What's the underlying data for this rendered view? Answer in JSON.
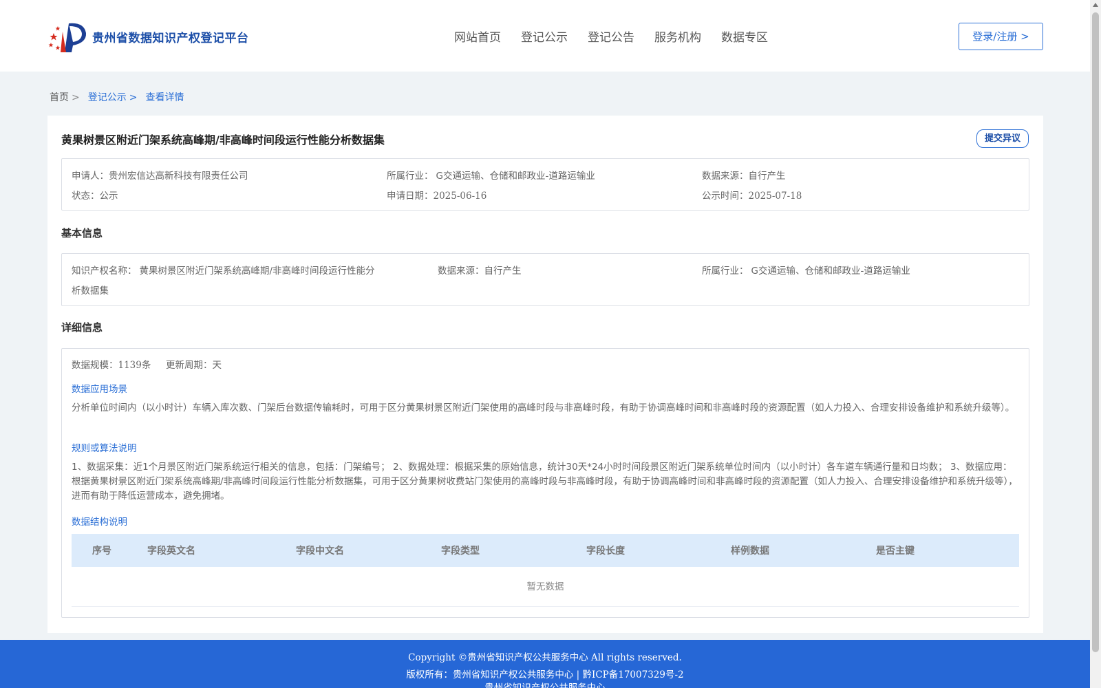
{
  "header": {
    "logo_text": "贵州省数据知识产权登记平台",
    "nav": [
      "网站首页",
      "登记公示",
      "登记公告",
      "服务机构",
      "数据专区"
    ],
    "login_label": "登录/注册 >"
  },
  "breadcrumb": {
    "home": "首页",
    "sep": ">",
    "level2": "登记公示",
    "current": "查看详情"
  },
  "detail": {
    "title": "黄果树景区附近门架系统高峰期/非高峰时间段运行性能分析数据集",
    "objection_label": "提交异议",
    "summary": {
      "applicant_label": "申请人：",
      "applicant": "贵州宏信达高新科技有限责任公司",
      "industry_label": "所属行业：",
      "industry": "G交通运输、仓储和邮政业-道路运输业",
      "source_label": "数据来源：",
      "source": "自行产生",
      "status_label": "状态：",
      "status": "公示",
      "apply_date_label": "申请日期：",
      "apply_date": "2025-06-16",
      "publish_date_label": "公示时间：",
      "publish_date": "2025-07-18"
    },
    "basic": {
      "heading": "基本信息",
      "ip_name_label": "知识产权名称：",
      "ip_name_line1": "黄果树景区附近门架系统高峰期/非高峰时间段运行性能分",
      "ip_name_line2": "析数据集",
      "source_label": "数据来源：",
      "source": "自行产生",
      "industry_label": "所属行业：",
      "industry": "G交通运输、仓储和邮政业-道路运输业"
    },
    "detailed": {
      "heading": "详细信息",
      "scale_label": "数据规模：",
      "scale": "1139条",
      "cycle_label": "更新周期：",
      "cycle": "天",
      "scenario_heading": "数据应用场景",
      "scenario_text": "分析单位时间内（以小时计）车辆入库次数、门架后台数据传输耗时，可用于区分黄果树景区附近门架使用的高峰时段与非高峰时段，有助于协调高峰时间和非高峰时段的资源配置（如人力投入、合理安排设备维护和系统升级等）。",
      "rules_heading": "规则或算法说明",
      "rules_text": "1、数据采集：近1个月景区附近门架系统运行相关的信息，包括：门架编号； 2、数据处理：根据采集的原始信息，统计30天*24小时时间段景区附近门架系统单位时间内（以小时计）各车道车辆通行量和日均数； 3、数据应用：根据黄果树景区附近门架系统高峰期/非高峰时间段运行性能分析数据集，可用于区分黄果树收费站门架使用的高峰时段与非高峰时段，有助于协调高峰时间和非高峰时段的资源配置（如人力投入、合理安排设备维护和系统升级等），进而有助于降低运营成本，避免拥堵。",
      "structure_heading": "数据结构说明",
      "table_headers": [
        "序号",
        "字段英文名",
        "字段中文名",
        "字段类型",
        "字段长度",
        "样例数据",
        "是否主键"
      ],
      "empty_text": "暂无数据"
    }
  },
  "footer": {
    "copyright": "Copyright ©贵州省知识产权公共服务中心 All rights reserved.",
    "owner": "版权所有：贵州省知识产权公共服务中心 | 黔ICP备17007329号-2",
    "org": "贵州省知识产权公共服务中心"
  },
  "colors": {
    "accent": "#2b6fd6",
    "brand": "#1d4fa8",
    "footer_bg": "#2667d6",
    "table_header_bg": "#dcebfb"
  }
}
